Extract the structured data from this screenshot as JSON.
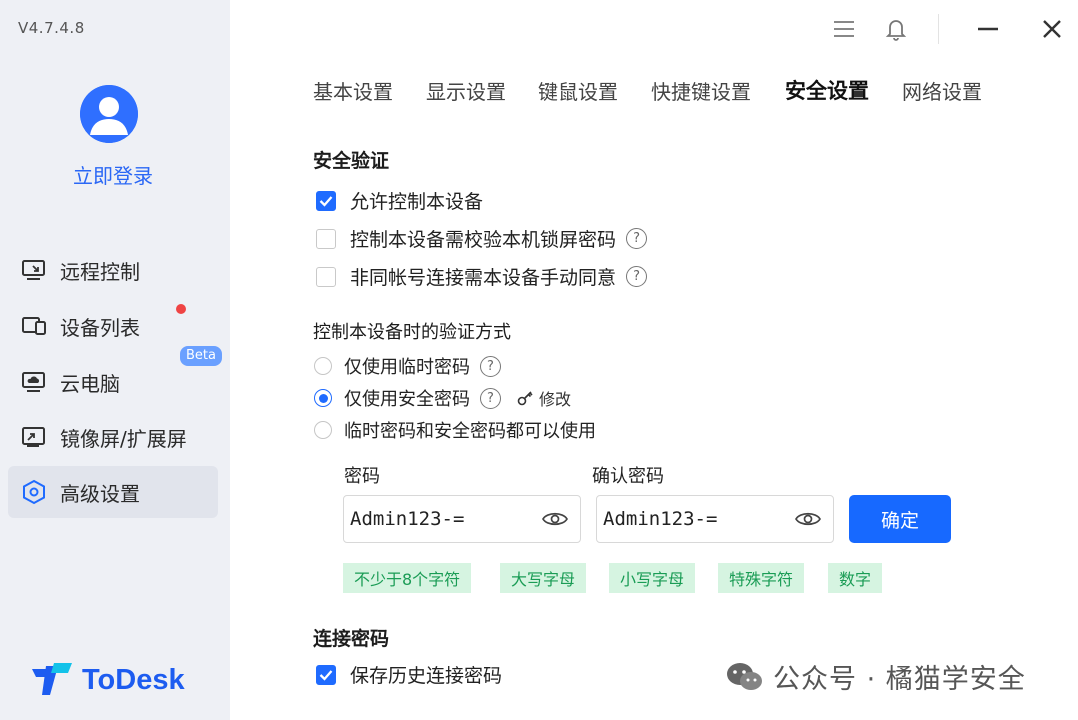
{
  "sidebar": {
    "version": "V4.7.4.8",
    "login_label": "立即登录",
    "items": [
      {
        "label": "远程控制",
        "icon": "remote-control-icon"
      },
      {
        "label": "设备列表",
        "icon": "device-list-icon",
        "badge": "red-dot"
      },
      {
        "label": "云电脑",
        "icon": "cloud-pc-icon",
        "tag": "Beta"
      },
      {
        "label": "镜像屏/扩展屏",
        "icon": "mirror-screen-icon"
      },
      {
        "label": "高级设置",
        "icon": "advanced-settings-icon",
        "active": true
      }
    ],
    "brand": "ToDesk"
  },
  "window_controls": [
    "menu-icon",
    "bell-icon",
    "minimize-icon",
    "close-icon"
  ],
  "tabs": [
    {
      "label": "基本设置"
    },
    {
      "label": "显示设置"
    },
    {
      "label": "键鼠设置"
    },
    {
      "label": "快捷键设置"
    },
    {
      "label": "安全设置",
      "active": true
    },
    {
      "label": "网络设置"
    }
  ],
  "security": {
    "title": "安全验证",
    "options": [
      {
        "label": "允许控制本设备",
        "checked": true
      },
      {
        "label": "控制本设备需校验本机锁屏密码",
        "checked": false,
        "help": true
      },
      {
        "label": "非同帐号连接需本设备手动同意",
        "checked": false,
        "help": true
      }
    ]
  },
  "verify": {
    "title": "控制本设备时的验证方式",
    "options": [
      {
        "label": "仅使用临时密码",
        "selected": false
      },
      {
        "label": "仅使用安全密码",
        "selected": true
      },
      {
        "label": "临时密码和安全密码都可以使用",
        "selected": false
      }
    ],
    "modify_label": "修改"
  },
  "password": {
    "label": "密码",
    "value": "Admin123-=",
    "confirm_label": "确认密码",
    "confirm_value": "Admin123-=",
    "button": "确定",
    "rules": [
      "不少于8个字符",
      "大写字母",
      "小写字母",
      "特殊字符",
      "数字"
    ]
  },
  "connection": {
    "title": "连接密码",
    "save_label": "保存历史连接密码",
    "checked": true
  },
  "watermark": "公众号 · 橘猫学安全",
  "colors": {
    "accent": "#1769ff",
    "sidebar_bg": "#eef0f5",
    "tag_bg": "#d6f4e1",
    "tag_text": "#1a9c55"
  }
}
